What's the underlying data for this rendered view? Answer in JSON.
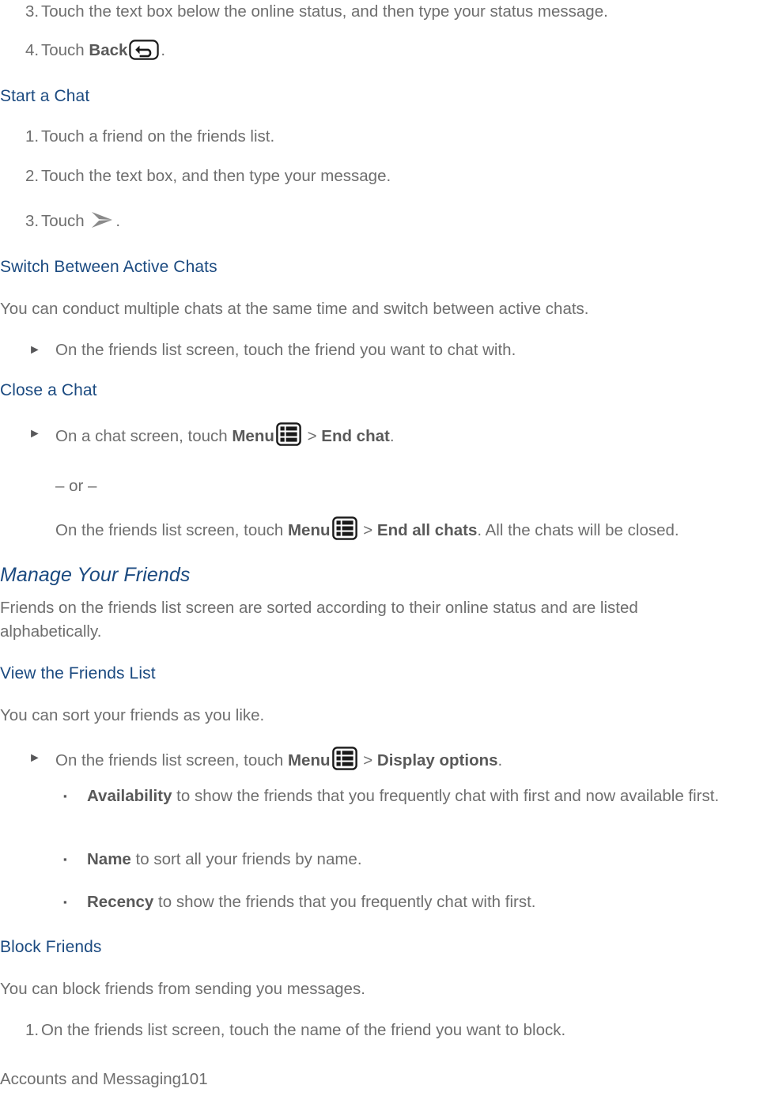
{
  "document": {
    "footer": {
      "section_label": "Accounts and Messaging",
      "page_number": "101"
    },
    "colors": {
      "heading": "#1b4a80",
      "body": "#6e6e6e",
      "bold": "#595959",
      "background": "#ffffff"
    }
  },
  "blocks": {
    "step_3_marker": "3.",
    "step_3_text": "Touch the text box below the online status, and then type your status message.",
    "step_4_marker": "4.",
    "step_4_prefix": "Touch ",
    "step_4_bold": "Back",
    "step_4_suffix": ".",
    "step_4_icon": "back-icon",
    "heading_start_a_chat": "Start a Chat",
    "start_1_marker": "1.",
    "start_1_text": "Touch a friend on the friends list.",
    "start_2_marker": "2.",
    "start_2_text": "Touch the text box, and then type your message.",
    "start_3_marker": "3.",
    "start_3_prefix": "Touch ",
    "start_3_suffix": ".",
    "start_3_icon": "send-icon",
    "heading_switch_between_active_chats": "Switch Between Active Chats",
    "switch_paragraph": "You can conduct multiple chats at the same time and switch between active chats.",
    "switch_bullet_marker": "►",
    "switch_bullet_text": "On the friends list screen, touch the friend you want to chat with.",
    "heading_close_a_chat": "Close a Chat",
    "close_bullet_marker": "►",
    "close_bullet_prefix": "On a chat screen, touch ",
    "close_bullet_bold_menu": "Menu",
    "close_bullet_icon": "menu-icon",
    "close_bullet_sep": " > ",
    "close_bullet_bold_action": "End chat",
    "close_bullet_suffix": ".",
    "or_divider": "– or –",
    "close_alt_prefix": "On the friends list screen, touch ",
    "close_alt_bold_menu": "Menu",
    "close_alt_icon": "menu-icon",
    "close_alt_sep": " > ",
    "close_alt_bold_action": "End all chats",
    "close_alt_suffix": ". All the chats will be closed.",
    "heading_manage_your_friends": "Manage Your Friends",
    "manage_paragraph": "Friends on the friends list screen are sorted according to their online status and are listed alphabetically.",
    "heading_view_the_friends_list": "View the Friends List",
    "view_paragraph": "You can sort your friends as you like.",
    "view_bullet_marker": "►",
    "view_bullet_prefix": "On the friends list screen, touch ",
    "view_bullet_bold_menu": "Menu",
    "view_bullet_icon": "menu-icon",
    "view_bullet_sep": " > ",
    "view_bullet_bold_action": "Display options",
    "view_bullet_suffix": ".",
    "sub_marker": "▪",
    "sub_1_bold": "Availability",
    "sub_1_text": " to show the friends that you frequently chat with first and now available first.",
    "sub_2_bold": "Name",
    "sub_2_text": " to sort all your friends by name.",
    "sub_3_bold": "Recency",
    "sub_3_text": " to show the friends that you frequently chat with first.",
    "heading_block_friends": "Block Friends",
    "block_paragraph": "You can block friends from sending you messages.",
    "block_1_marker": "1.",
    "block_1_text": "On the friends list screen, touch the name of the friend you want to block."
  }
}
